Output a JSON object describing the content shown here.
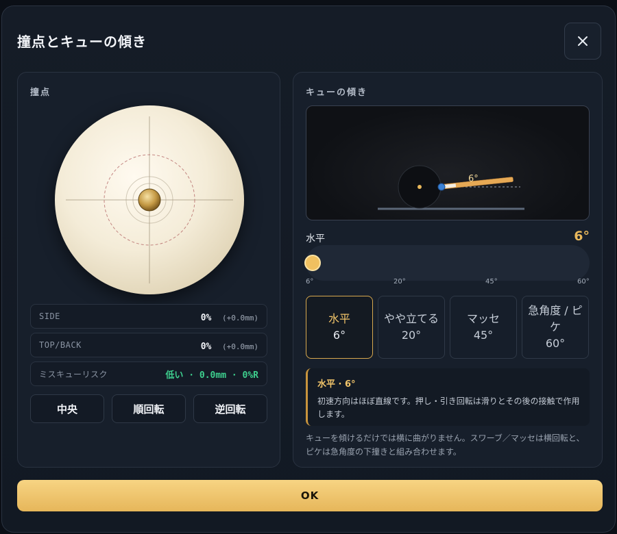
{
  "dialog": {
    "title": "撞点とキューの傾き",
    "close_icon": "close-icon"
  },
  "contact": {
    "heading": "撞点",
    "stats": {
      "side": {
        "label": "SIDE",
        "value": "0%",
        "sub": "(+0.0mm)"
      },
      "topback": {
        "label": "TOP/BACK",
        "value": "0%",
        "sub": "(+0.0mm)"
      },
      "risk": {
        "label": "ミスキューリスク",
        "value": "低い · 0.0mm · 0%R"
      }
    },
    "buttons": {
      "center": "中央",
      "follow": "順回転",
      "draw": "逆回転"
    }
  },
  "tilt": {
    "heading": "キューの傾き",
    "preview_angle": "6°",
    "slider": {
      "label": "水平",
      "value": "6°",
      "fraction": 0,
      "ticks": [
        "6°",
        "20°",
        "45°",
        "60°"
      ]
    },
    "presets": [
      {
        "name": "水平",
        "deg": "6°"
      },
      {
        "name": "やや立てる",
        "deg": "20°"
      },
      {
        "name": "マッセ",
        "deg": "45°"
      },
      {
        "name": "急角度 / ピケ",
        "deg": "60°"
      }
    ],
    "info": {
      "title": "水平 · 6°",
      "body": "初速方向はほぼ直線です。押し・引き回転は滑りとその後の接触で作用します。"
    },
    "note": "キューを傾けるだけでは横に曲がりません。スワーブ／マッセは横回転と、ピケは急角度の下撞きと組み合わせます。"
  },
  "footer": {
    "ok_label": "OK"
  },
  "colors": {
    "accent": "#e9b85b",
    "risk_ok": "#3ecf8e"
  }
}
